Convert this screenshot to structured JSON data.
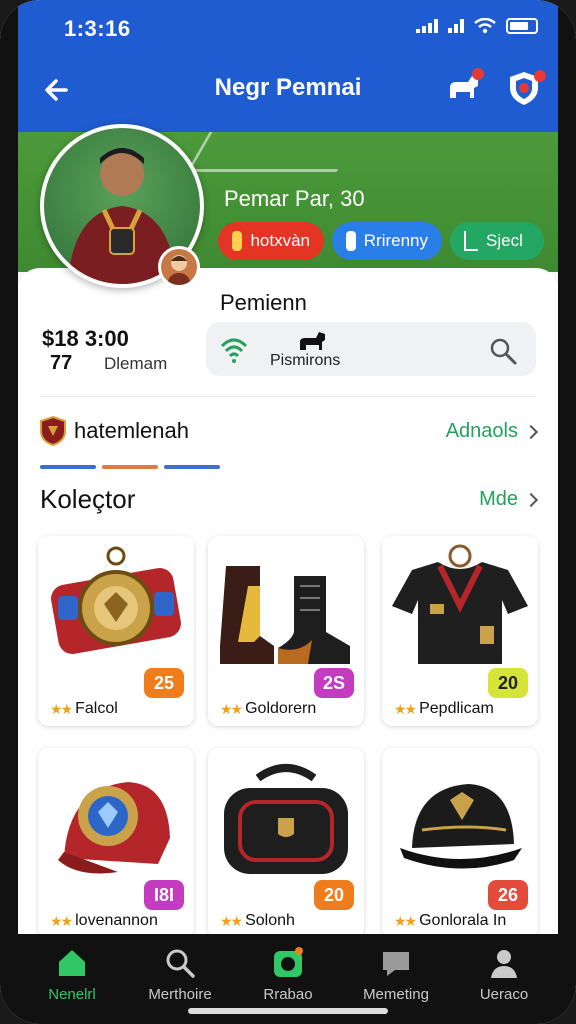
{
  "status_bar": {
    "time": "1:3:16"
  },
  "app_bar": {
    "title": "Negr Pemnai"
  },
  "profile": {
    "player_name": "Pemar Par, 30",
    "pills": [
      {
        "label": "hotxvàn",
        "color": "#e33424"
      },
      {
        "label": "Rrirenny",
        "color": "#2a7ee8"
      },
      {
        "label": "Sjecl",
        "color": "#25a764"
      }
    ]
  },
  "stats": {
    "value": "$18 3:00",
    "count": "77",
    "label": "Dlemam"
  },
  "search": {
    "section_title": "Pemienn",
    "text": "Pismirons"
  },
  "team": {
    "name": "hatemlenah",
    "link": "Adnaols"
  },
  "tabs_colors": [
    "#3b6fd4",
    "#e07b3a",
    "#3b6fd4"
  ],
  "collection": {
    "title": "Koleçtor",
    "link": "Mde",
    "items": [
      {
        "label": "Falcol",
        "count": "25",
        "badge_color": "#f07d1c",
        "icon": "championship-belt-icon"
      },
      {
        "label": "Goldorern",
        "count": "2S",
        "badge_color": "#c33cc0",
        "icon": "boots-icon"
      },
      {
        "label": "Pepdlicam",
        "count": "20",
        "badge_color": "#d6e43a",
        "icon": "jersey-icon"
      },
      {
        "label": "lovenannon",
        "count": "I8I",
        "badge_color": "#c33cc0",
        "icon": "red-cap-icon"
      },
      {
        "label": "Solonh",
        "count": "20",
        "badge_color": "#f07d1c",
        "icon": "bag-icon"
      },
      {
        "label": "Gonlorala In",
        "count": "26",
        "badge_color": "#e34b3a",
        "icon": "black-cap-icon"
      }
    ]
  },
  "bottom_nav": [
    {
      "label": "Nenelrl",
      "icon": "home-icon",
      "active": true
    },
    {
      "label": "Merthoire",
      "icon": "search-icon",
      "active": false
    },
    {
      "label": "Rrabao",
      "icon": "camera-icon",
      "active": false
    },
    {
      "label": "Memeting",
      "icon": "chat-icon",
      "active": false
    },
    {
      "label": "Ueraco",
      "icon": "profile-icon",
      "active": false
    }
  ]
}
